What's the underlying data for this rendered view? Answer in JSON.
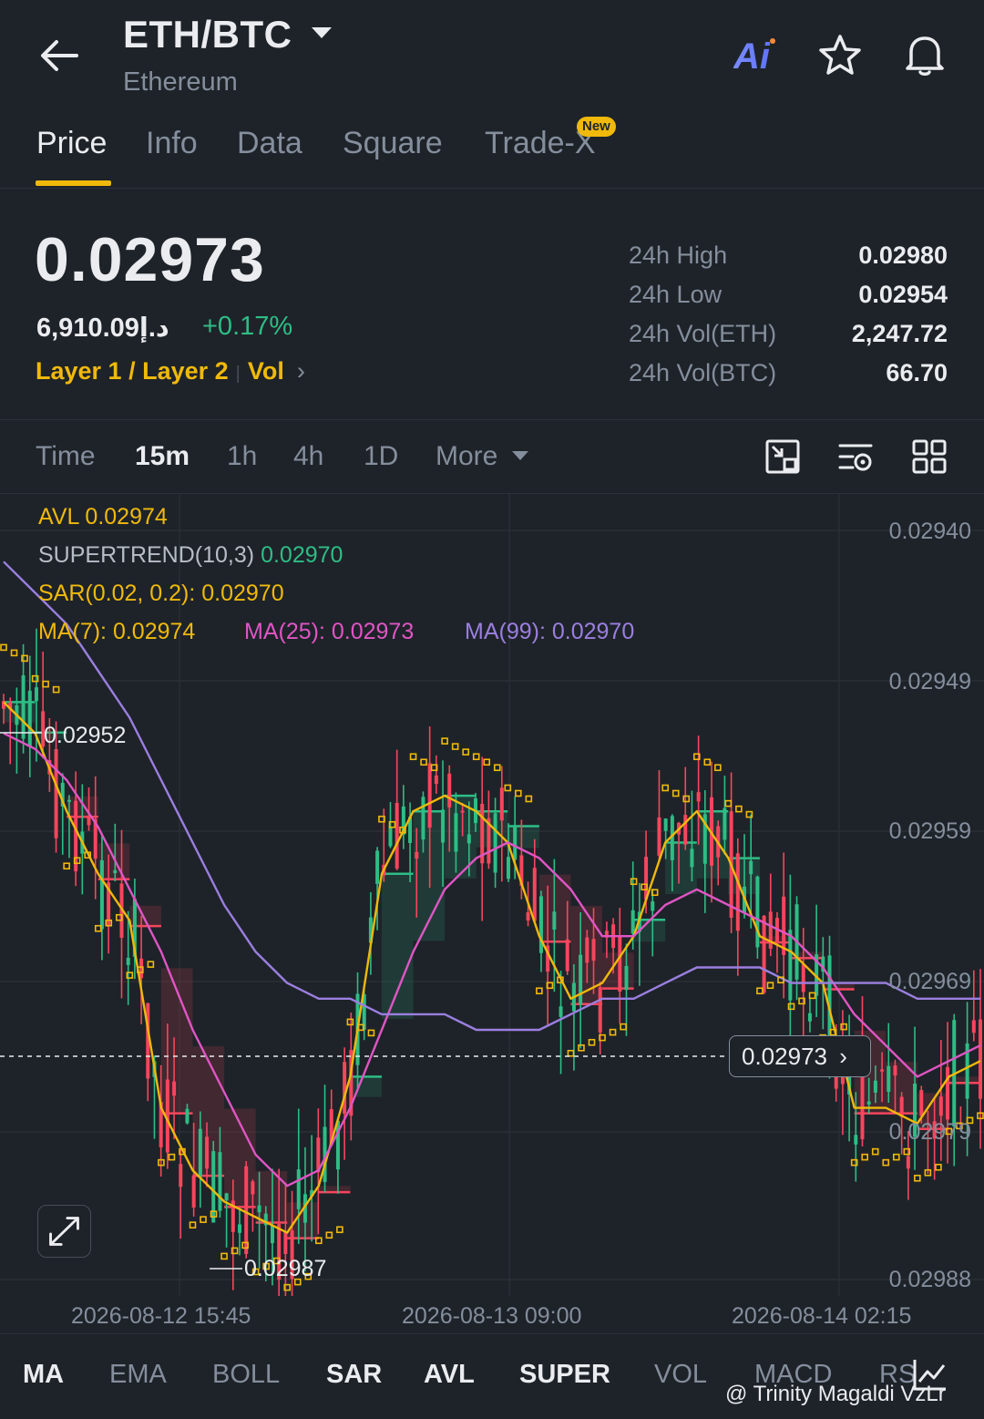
{
  "header": {
    "pair": "ETH/BTC",
    "subtitle": "Ethereum",
    "ai_label": "Ai"
  },
  "tabs": [
    {
      "label": "Price",
      "active": true
    },
    {
      "label": "Info"
    },
    {
      "label": "Data"
    },
    {
      "label": "Square"
    },
    {
      "label": "Trade-X"
    }
  ],
  "new_badge": "New",
  "price": {
    "last": "0.02973",
    "fiat": "6,910.09د.إ",
    "change": "+0.17%",
    "tag1": "Layer 1 / Layer 2",
    "tag2": "Vol"
  },
  "stats": [
    {
      "label": "24h High",
      "value": "0.02980"
    },
    {
      "label": "24h Low",
      "value": "0.02954"
    },
    {
      "label": "24h Vol(ETH)",
      "value": "2,247.72"
    },
    {
      "label": "24h Vol(BTC)",
      "value": "66.70"
    }
  ],
  "intervals": [
    "Time",
    "15m",
    "1h",
    "4h",
    "1D",
    "More"
  ],
  "active_interval": "15m",
  "indicators": {
    "avl": "AVL 0.02974",
    "supertrend_label": "SUPERTREND(10,3)",
    "supertrend_value": "0.02970",
    "sar": "SAR(0.02, 0.2): 0.02970",
    "ma7": "MA(7): 0.02974",
    "ma25": "MA(25): 0.02973",
    "ma99": "MA(99): 0.02970"
  },
  "colors": {
    "up": "#2ebd85",
    "down": "#f6465d",
    "accent": "#f0b90b",
    "ma7": "#f0b90b",
    "ma25": "#e055c4",
    "ma99": "#9b7fe0",
    "sar": "#f0b90b"
  },
  "chart_labels": {
    "high_marker": "0.02952",
    "low_marker": "0.02987",
    "current_price": "0.02973"
  },
  "chart_data": {
    "type": "line",
    "y_ticks": [
      "0.02940",
      "0.02949",
      "0.02959",
      "0.02969",
      "0.02979",
      "0.02988"
    ],
    "x_ticks": [
      "2026-08-12 15:45",
      "2026-08-13 09:00",
      "2026-08-14 02:15"
    ],
    "series": [
      {
        "name": "MA(7)",
        "values": [
          0.02951,
          0.02953,
          0.02958,
          0.02962,
          0.02965,
          0.02977,
          0.02981,
          0.02983,
          0.02984,
          0.02985,
          0.02982,
          0.02975,
          0.02962,
          0.02958,
          0.02957,
          0.02958,
          0.0296,
          0.02966,
          0.0297,
          0.02969,
          0.02966,
          0.0296,
          0.02958,
          0.02961,
          0.02966,
          0.02967,
          0.02969,
          0.02977,
          0.02977,
          0.02978,
          0.02975,
          0.02974
        ]
      },
      {
        "name": "MA(25)",
        "values": [
          0.02953,
          0.02954,
          0.02956,
          0.02959,
          0.02963,
          0.02967,
          0.02972,
          0.02976,
          0.0298,
          0.02982,
          0.02981,
          0.02977,
          0.02972,
          0.02967,
          0.02963,
          0.02961,
          0.0296,
          0.02961,
          0.02963,
          0.02966,
          0.02966,
          0.02964,
          0.02963,
          0.02964,
          0.02965,
          0.02966,
          0.02968,
          0.02971,
          0.02973,
          0.02975,
          0.02974,
          0.02973
        ]
      },
      {
        "name": "MA(99)",
        "values": [
          0.02942,
          0.02944,
          0.02946,
          0.02949,
          0.02952,
          0.02956,
          0.0296,
          0.02964,
          0.02967,
          0.02969,
          0.0297,
          0.0297,
          0.02971,
          0.02971,
          0.02971,
          0.02972,
          0.02972,
          0.02972,
          0.02971,
          0.0297,
          0.0297,
          0.02969,
          0.02968,
          0.02968,
          0.02968,
          0.02969,
          0.02969,
          0.02969,
          0.02969,
          0.0297,
          0.0297,
          0.0297
        ]
      }
    ]
  },
  "bottom_tabs": [
    "MA",
    "EMA",
    "BOLL",
    "SAR",
    "AVL",
    "SUPER",
    "VOL",
    "MACD",
    "RS"
  ],
  "bottom_active": [
    "MA",
    "SAR",
    "AVL",
    "SUPER"
  ],
  "watermark": "@ Trinity Magaldi VzLr"
}
